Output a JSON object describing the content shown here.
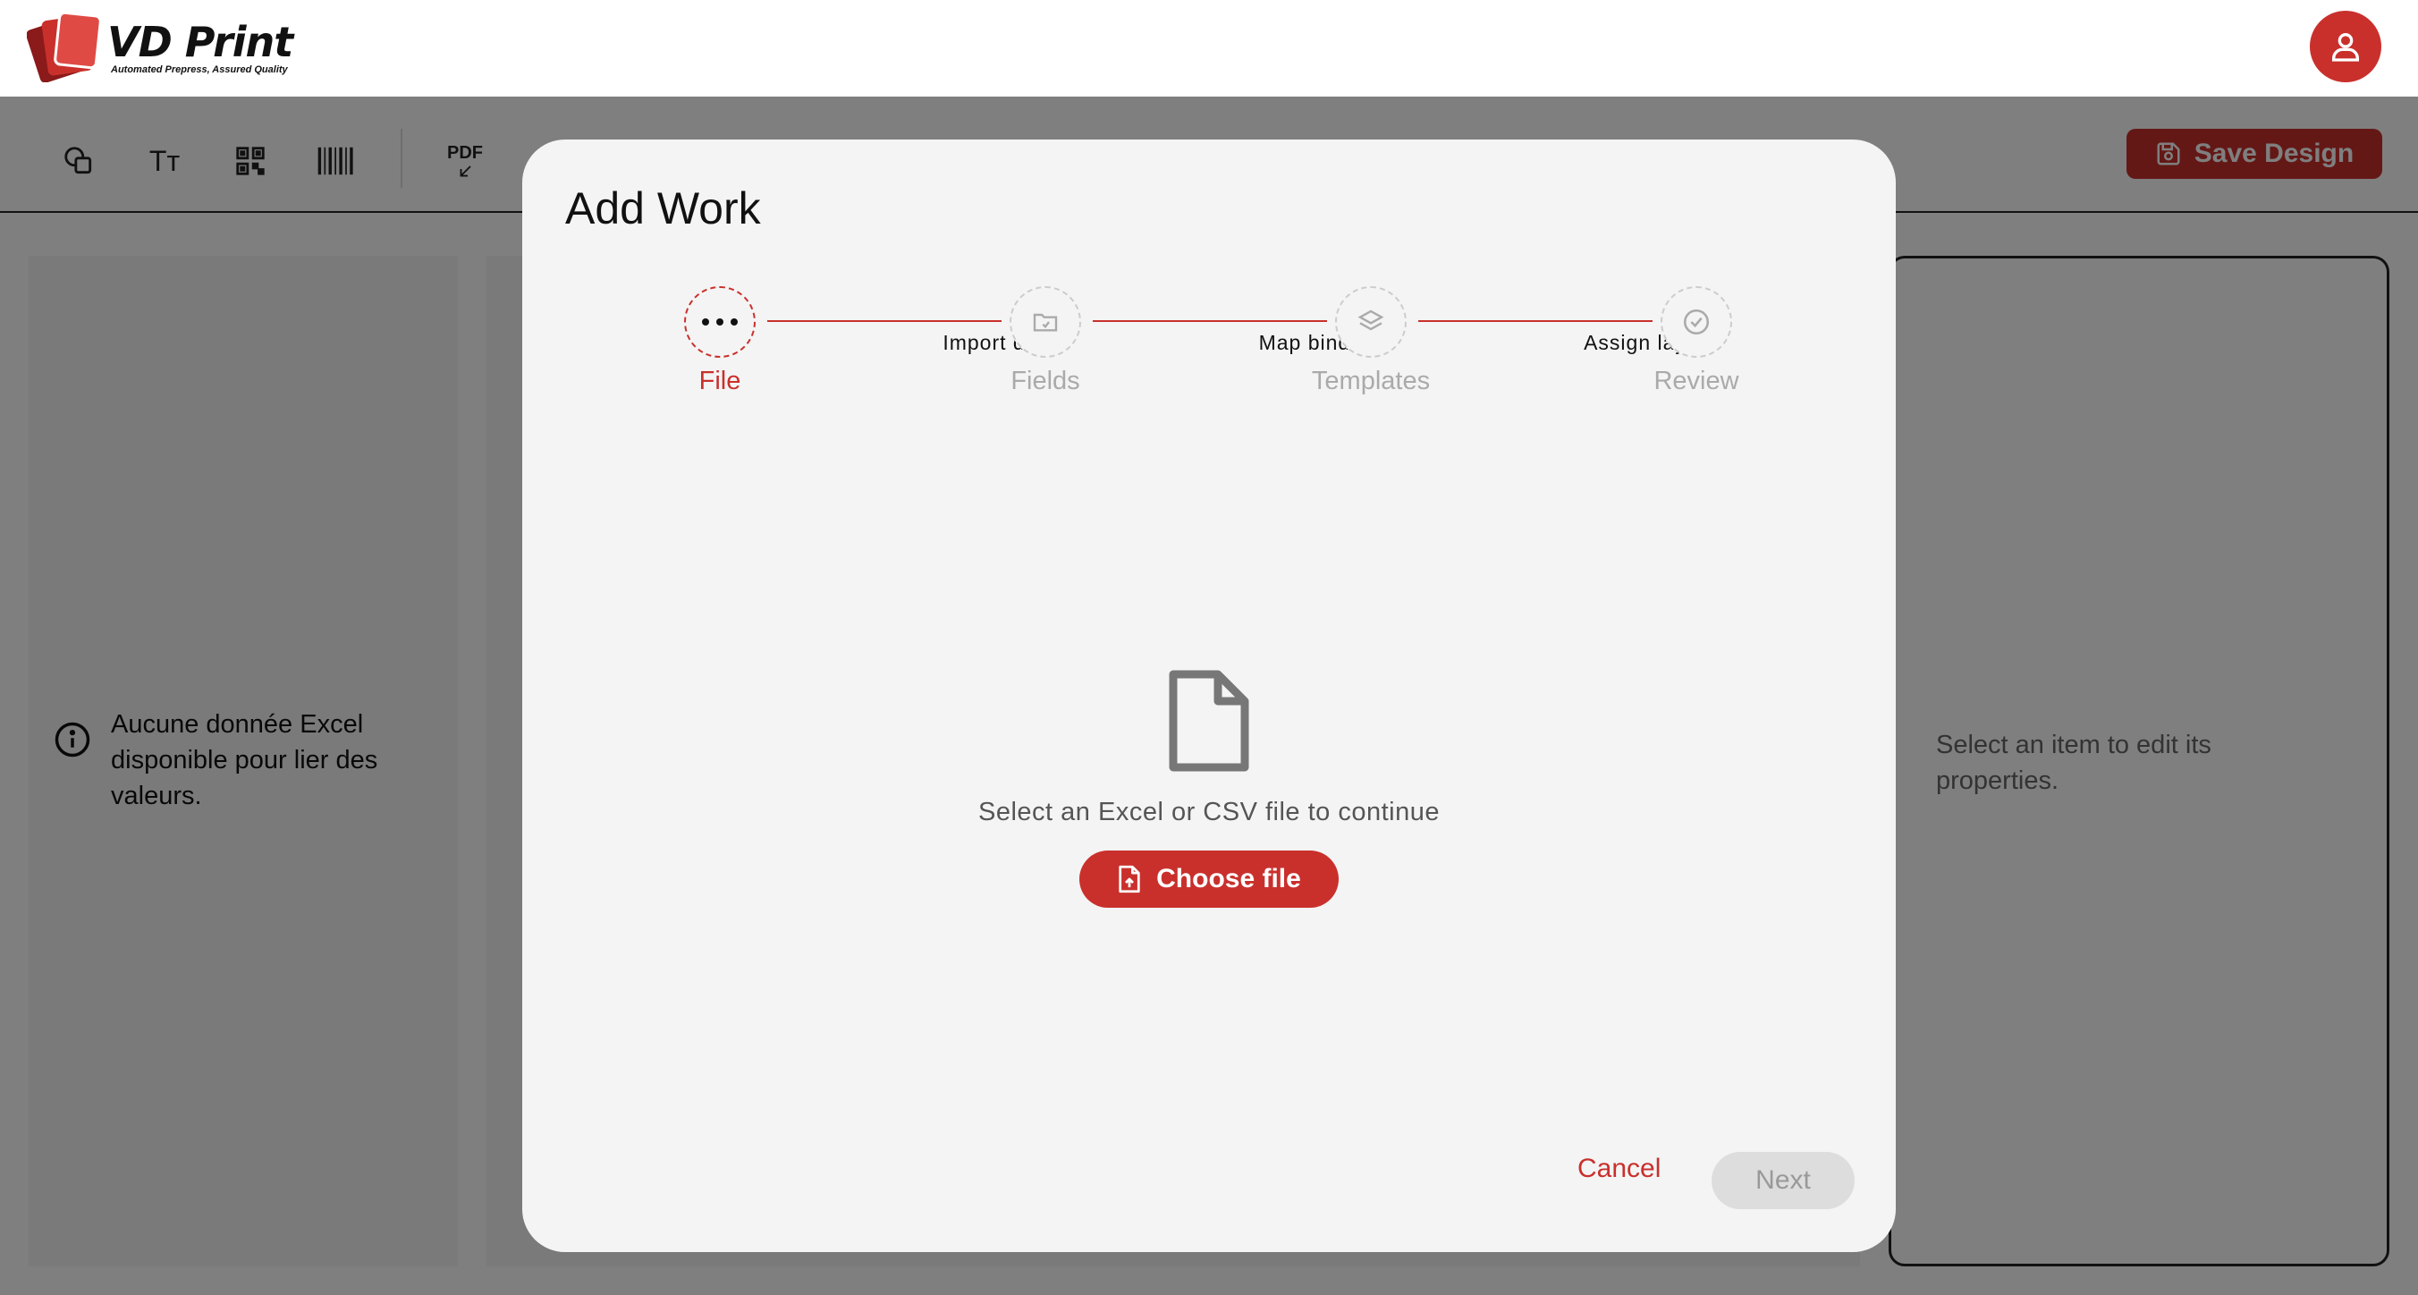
{
  "header": {
    "logo_title": "VD Print",
    "logo_tagline": "Automated Prepress, Assured Quality"
  },
  "toolbar": {
    "text_tool_glyph": "Tт",
    "pdf_label": "PDF",
    "save_label": "Save Design"
  },
  "left_panel": {
    "empty_message": "Aucune donnée Excel disponible pour lier des valeurs."
  },
  "right_panel": {
    "hint": "Select an item to edit its properties."
  },
  "modal": {
    "title": "Add Work",
    "steps": [
      {
        "label": "File",
        "icon": "more-dots-icon",
        "state": "active"
      },
      {
        "label": "Fields",
        "icon": "folder-icon",
        "state": "pending"
      },
      {
        "label": "Templates",
        "icon": "layers-icon",
        "state": "pending"
      },
      {
        "label": "Review",
        "icon": "check-circle-icon",
        "state": "pending"
      }
    ],
    "connectors": [
      "Import data",
      "Map bindings",
      "Assign layout"
    ],
    "empty_state": {
      "message": "Select an Excel or CSV file to continue",
      "button_label": "Choose file"
    },
    "cancel_label": "Cancel",
    "next_label": "Next"
  },
  "colors": {
    "accent": "#c9302c",
    "overlay": "#000000"
  }
}
